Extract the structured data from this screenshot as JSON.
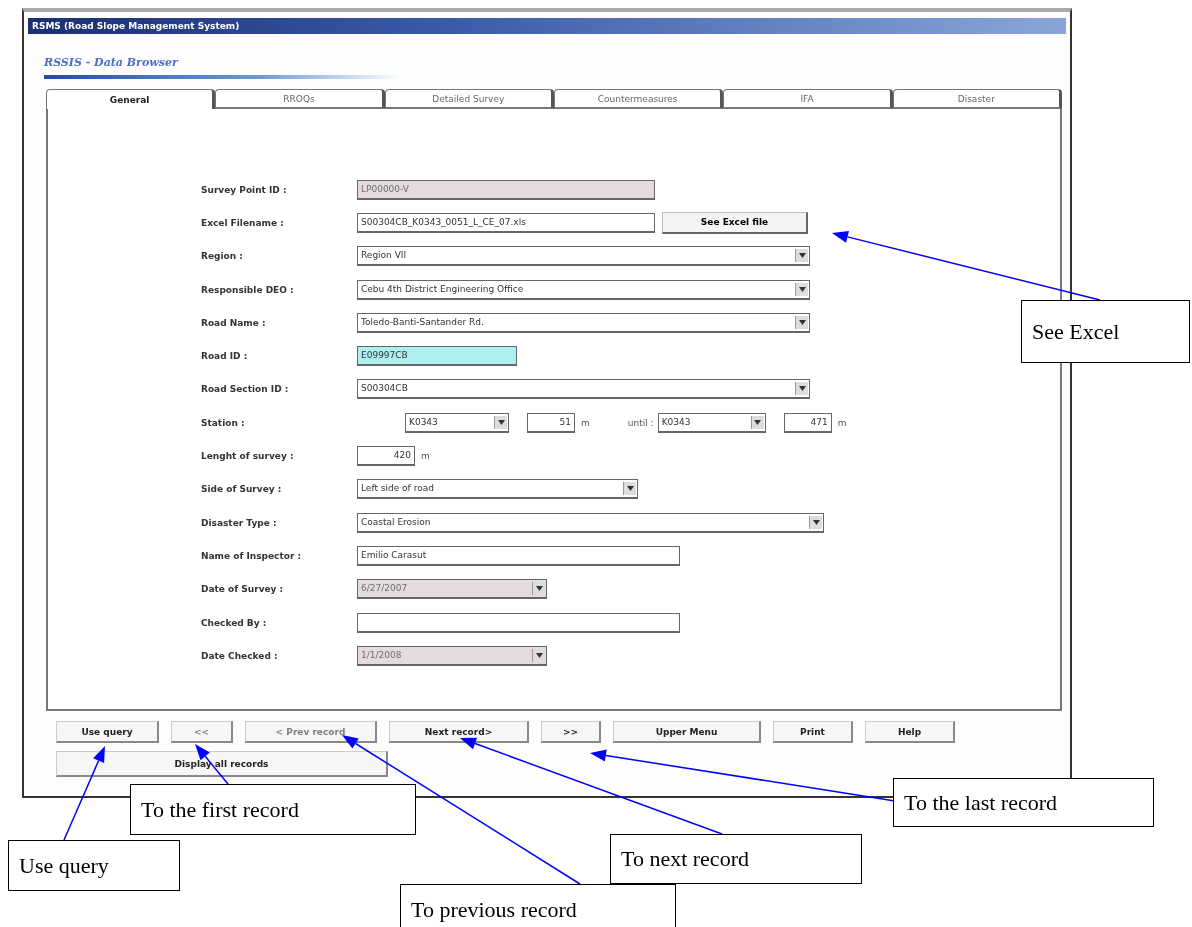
{
  "window": {
    "title": "RSMS (Road Slope Management System)"
  },
  "heading": "RSSIS - Data Browser",
  "tabs": [
    {
      "label": "General",
      "selected": true
    },
    {
      "label": "RROQs",
      "selected": false
    },
    {
      "label": "Detailed Survey",
      "selected": false
    },
    {
      "label": "Countermeasures",
      "selected": false
    },
    {
      "label": "IFA",
      "selected": false
    },
    {
      "label": "Disaster",
      "selected": false
    }
  ],
  "fields": [
    {
      "kind": "text",
      "label": "Survey Point ID :",
      "value": "LP00000-V",
      "disabled": true,
      "highlighted": false
    },
    {
      "kind": "file",
      "label": "Excel Filename :",
      "value": "S00304CB_K0343_0051_L_CE_07.xls",
      "button": "See Excel file"
    },
    {
      "kind": "select",
      "label": "Region :",
      "value": "Region VII"
    },
    {
      "kind": "select",
      "label": "Responsible DEO :",
      "value": "Cebu 4th District Engineering Office"
    },
    {
      "kind": "select",
      "label": "Road Name :",
      "value": "Toledo-Banti-Santander Rd."
    },
    {
      "kind": "text",
      "label": "Road ID :",
      "value": "E09997CB",
      "disabled": false,
      "highlighted": true
    },
    {
      "kind": "select",
      "label": "Road Section ID :",
      "value": "S00304CB"
    },
    {
      "kind": "station",
      "label": "Station :",
      "from_km": "K0343",
      "from_m": "51",
      "unit": "m",
      "until_label": "until :",
      "to_km": "K0343",
      "to_m": "471",
      "to_unit": "m"
    },
    {
      "kind": "number",
      "label": "Lenght of survey :",
      "value": "420",
      "unit": "m"
    },
    {
      "kind": "select",
      "label": "Side of Survey :",
      "value": "Left side of road"
    },
    {
      "kind": "select",
      "label": "Disaster Type :",
      "value": "Coastal Erosion"
    },
    {
      "kind": "text",
      "label": "Name of Inspector :",
      "value": "Emilio Carasut",
      "disabled": false,
      "highlighted": false
    },
    {
      "kind": "date",
      "label": "Date of Survey :",
      "value": "6/27/2007",
      "disabled": true
    },
    {
      "kind": "text",
      "label": "Checked By :",
      "disabled": false,
      "highlighted": false
    },
    {
      "kind": "date",
      "label": "Date Checked :",
      "value": "1/1/2008",
      "disabled": true
    }
  ],
  "buttons": [
    {
      "label": "Use query",
      "disabled": false
    },
    {
      "label": "<<",
      "disabled": true
    },
    {
      "label": "< Prev record",
      "disabled": true
    },
    {
      "label": "Next record>",
      "disabled": false
    },
    {
      "label": ">>",
      "disabled": false
    },
    {
      "label": "Upper Menu",
      "disabled": false
    },
    {
      "label": "Print",
      "disabled": false
    },
    {
      "label": "Help",
      "disabled": false
    }
  ],
  "display_all_button": {
    "label": "Display all records",
    "disabled": false
  },
  "annotations": [
    {
      "text": "See Excel"
    },
    {
      "text": "To the first record"
    },
    {
      "text": "Use query"
    },
    {
      "text": "To previous record"
    },
    {
      "text": "To next record"
    },
    {
      "text": "To the last record"
    }
  ]
}
